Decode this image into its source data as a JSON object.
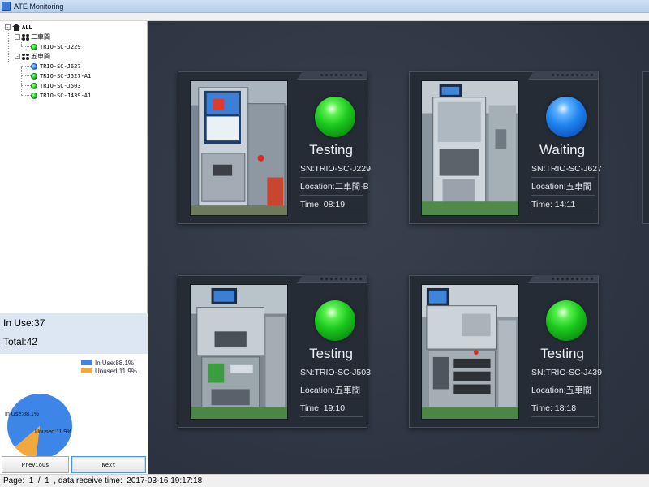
{
  "window": {
    "title": "ATE Monitoring"
  },
  "tree": {
    "root": {
      "label": "ALL",
      "expander": "-"
    },
    "groups": [
      {
        "label": "二車間",
        "expander": "-",
        "items": [
          {
            "label": "TRIO-SC-J229",
            "status_color": "green"
          }
        ]
      },
      {
        "label": "五車間",
        "expander": "-",
        "items": [
          {
            "label": "TRIO-SC-J627",
            "status_color": "blue"
          },
          {
            "label": "TRIO-SC-J527-A1",
            "status_color": "green"
          },
          {
            "label": "TRIO-SC-J503",
            "status_color": "green"
          },
          {
            "label": "TRIO-SC-J439-A1",
            "status_color": "green"
          }
        ]
      }
    ]
  },
  "stats": {
    "in_use": "In Use:37",
    "total": "Total:42"
  },
  "chart_data": {
    "type": "pie",
    "categories": [
      "In Use",
      "Unused"
    ],
    "values": [
      88.1,
      11.9
    ],
    "colors": [
      "#3d86e8",
      "#f2a83a"
    ],
    "legend": [
      "In Use:88.1%",
      "Unused:11.9%"
    ],
    "slice_labels": [
      "In Use:88.1%",
      "Unused:11.9%"
    ],
    "legend_position": "top-right"
  },
  "buttons": {
    "previous": "Previous",
    "next": "Next"
  },
  "statusbar": {
    "text": "Page:  1  /  1  , data receive time:  2017-03-16 19:17:18"
  },
  "colors": {
    "testing": "#1bc91e",
    "waiting": "#1f84ef",
    "dashboard_bg": "#2f3644"
  },
  "cards": [
    {
      "status": "Testing",
      "orb": "green",
      "sn": "SN:TRIO-SC-J229",
      "location": "Location:二車間-B",
      "time": "Time: 08:19"
    },
    {
      "status": "Waiting",
      "orb": "blue",
      "sn": "SN:TRIO-SC-J627",
      "location": "Location:五車間",
      "time": "Time: 14:11"
    },
    {
      "status": "Testing",
      "orb": "green",
      "sn": "SN:TRIO-SC-J503",
      "location": "Location:五車間",
      "time": "Time: 19:10"
    },
    {
      "status": "Testing",
      "orb": "green",
      "sn": "SN:TRIO-SC-J439",
      "location": "Location:五車間",
      "time": "Time: 18:18"
    }
  ]
}
